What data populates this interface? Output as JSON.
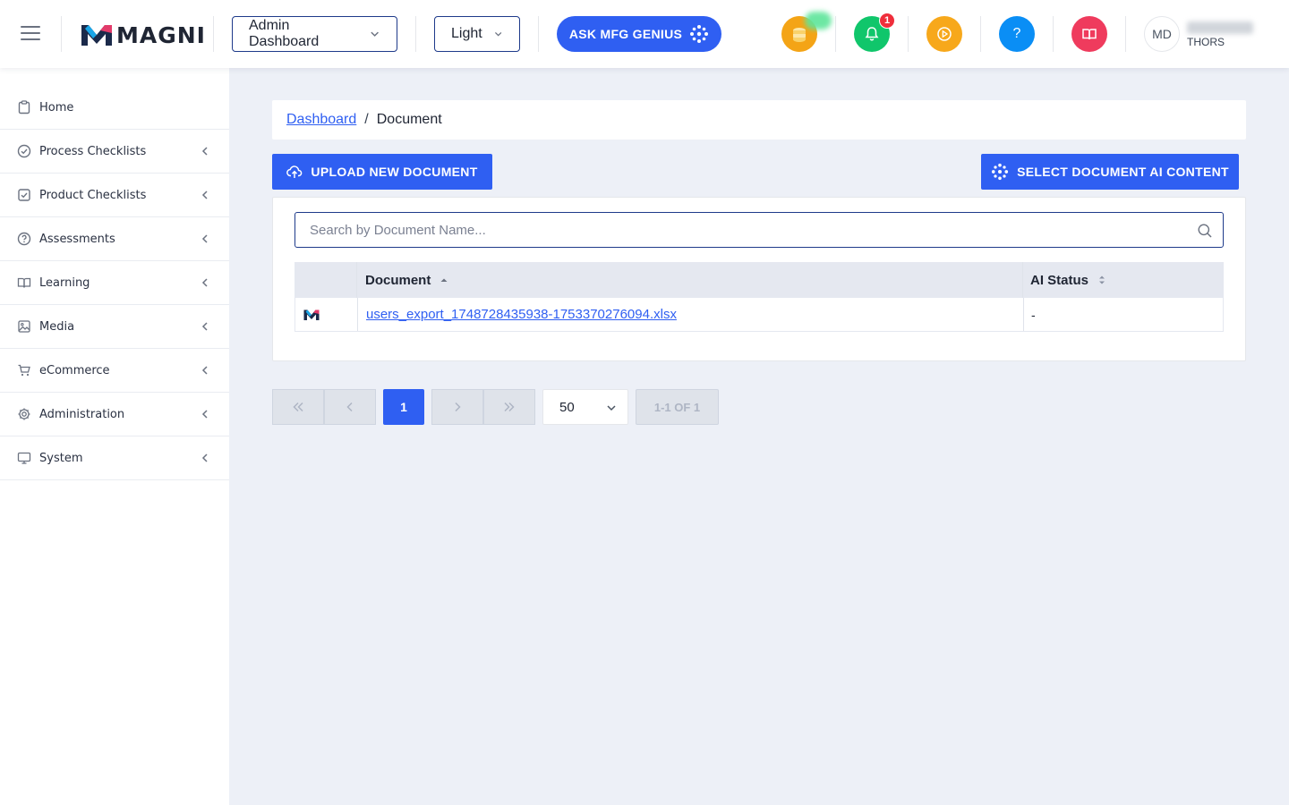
{
  "header": {
    "logo_text": "MAGNI",
    "dashboard_select": "Admin Dashboard",
    "theme_select": "Light",
    "ask_button": "ASK MFG GENIUS",
    "notification_count": "1",
    "help_label": "?",
    "user_initials": "MD",
    "user_company": "THORS"
  },
  "sidebar": {
    "items": [
      {
        "label": "Home",
        "icon": "clipboard-icon"
      },
      {
        "label": "Process Checklists",
        "icon": "check-circle-icon"
      },
      {
        "label": "Product Checklists",
        "icon": "check-square-icon"
      },
      {
        "label": "Assessments",
        "icon": "question-circle-icon"
      },
      {
        "label": "Learning",
        "icon": "book-open-icon"
      },
      {
        "label": "Media",
        "icon": "image-icon"
      },
      {
        "label": "eCommerce",
        "icon": "cart-icon"
      },
      {
        "label": "Administration",
        "icon": "gear-icon"
      },
      {
        "label": "System",
        "icon": "monitor-icon"
      }
    ]
  },
  "breadcrumb": {
    "parent": "Dashboard",
    "separator": "/",
    "current": "Document"
  },
  "actions": {
    "upload": "UPLOAD NEW DOCUMENT",
    "select_ai": "SELECT DOCUMENT AI CONTENT"
  },
  "search": {
    "placeholder": "Search by Document Name..."
  },
  "table": {
    "headers": [
      "",
      "Document",
      "AI Status"
    ],
    "rows": [
      {
        "document": "users_export_1748728435938-1753370276094.xlsx",
        "ai_status": "-"
      }
    ]
  },
  "pagination": {
    "current_page": "1",
    "page_size": "50",
    "range_info": "1-1 OF 1"
  },
  "colors": {
    "primary": "#2f5ff2",
    "coins": "#f4a416",
    "bell": "#10c66b",
    "play": "#f7a81b",
    "help": "#0a8ef5",
    "book": "#ef3b5d"
  }
}
